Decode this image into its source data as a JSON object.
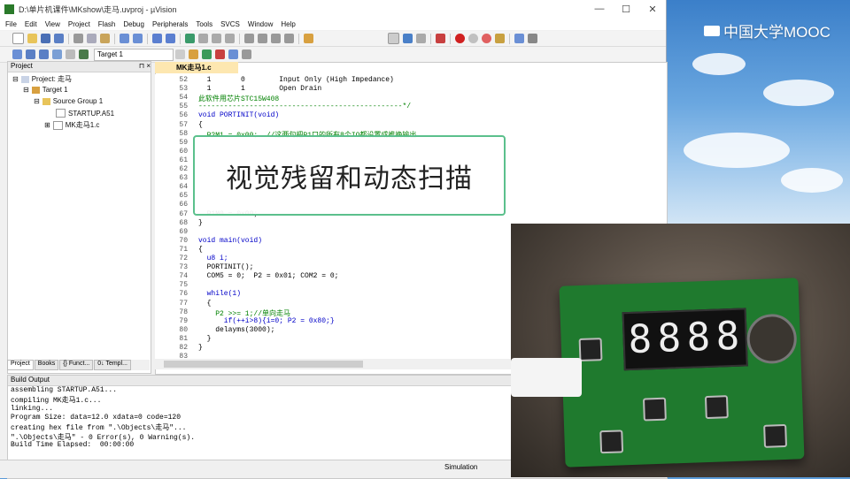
{
  "window": {
    "title": "D:\\单片机课件\\MKshow\\走马.uvproj - µVision",
    "controls": [
      "—",
      "☐",
      "✕"
    ]
  },
  "menu": [
    "File",
    "Edit",
    "View",
    "Project",
    "Flash",
    "Debug",
    "Peripherals",
    "Tools",
    "SVCS",
    "Window",
    "Help"
  ],
  "toolbar": {
    "target": "Target 1"
  },
  "project": {
    "header": "Project",
    "pin": "⊓ ×",
    "tree": [
      {
        "label": "Project: 走马"
      },
      {
        "label": "Target 1"
      },
      {
        "label": "Source Group 1"
      },
      {
        "label": "STARTUP.A51"
      },
      {
        "label": "MK走马1.c"
      }
    ],
    "tabs": [
      "Project",
      "Books",
      "{} Funct...",
      "0↓ Templ..."
    ]
  },
  "editor": {
    "tab": "MK走马1.c",
    "lines": [
      {
        "n": "52",
        "t": "  1       0        Input Only (High Impedance)"
      },
      {
        "n": "53",
        "t": "  1       1        Open Drain"
      },
      {
        "n": "54",
        "t": "此软件用芯片STC15W408"
      },
      {
        "n": "55",
        "t": "------------------------------------------------*/"
      },
      {
        "n": "56",
        "t": "void PORTINIT(void)"
      },
      {
        "n": "57",
        "t": "{"
      },
      {
        "n": "58",
        "t": "  P2M1 = 0x00;  //这两句把P1口的所有8个IO都设置成推挽输出"
      },
      {
        "n": "59",
        "t": ""
      },
      {
        "n": "60",
        "t": ""
      },
      {
        "n": "61",
        "t": ""
      },
      {
        "n": "62",
        "t": ""
      },
      {
        "n": "63",
        "t": ""
      },
      {
        "n": "64",
        "t": ""
      },
      {
        "n": "65",
        "t": ""
      },
      {
        "n": "66",
        "t": ""
      },
      {
        "n": "67",
        "t": "  P1M0 = 0x00;"
      },
      {
        "n": "68",
        "t": "}"
      },
      {
        "n": "69",
        "t": ""
      },
      {
        "n": "70",
        "t": "void main(void)"
      },
      {
        "n": "71",
        "t": "{"
      },
      {
        "n": "72",
        "t": "  u8 i;"
      },
      {
        "n": "73",
        "t": "  PORTINIT();"
      },
      {
        "n": "74",
        "t": "  COM5 = 0;  P2 = 0x01; COM2 = 0;"
      },
      {
        "n": "75",
        "t": ""
      },
      {
        "n": "76",
        "t": "  while(1)"
      },
      {
        "n": "77",
        "t": "  {"
      },
      {
        "n": "78",
        "t": "    P2 >>= 1;//单向走马"
      },
      {
        "n": "79",
        "t": "      if(++i>8){i=0; P2 = 0x80;}"
      },
      {
        "n": "80",
        "t": "    delayms(3000);"
      },
      {
        "n": "81",
        "t": "  }"
      },
      {
        "n": "82",
        "t": "}"
      },
      {
        "n": "83",
        "t": ""
      }
    ]
  },
  "banner": "视觉残留和动态扫描",
  "build": {
    "header": "Build Output",
    "lines": [
      "assembling STARTUP.A51...",
      "compiling MK走马1.c...",
      "linking...",
      "Program Size: data=12.0 xdata=0 code=120",
      "creating hex file from \".\\Objects\\走马\"...",
      "\".\\Objects\\走马\" - 0 Error(s), 0 Warning(s).",
      "Build Time Elapsed:  00:00:00"
    ]
  },
  "status": "Simulation",
  "watermark": "中国大学MOOC",
  "photo": {
    "display_digits": [
      "8",
      "8",
      "8",
      "8"
    ]
  },
  "colors": {
    "banner_border": "#5bc08c",
    "keyword": "#0000c8",
    "comment": "#008000",
    "pcb": "#1f7a2e"
  }
}
